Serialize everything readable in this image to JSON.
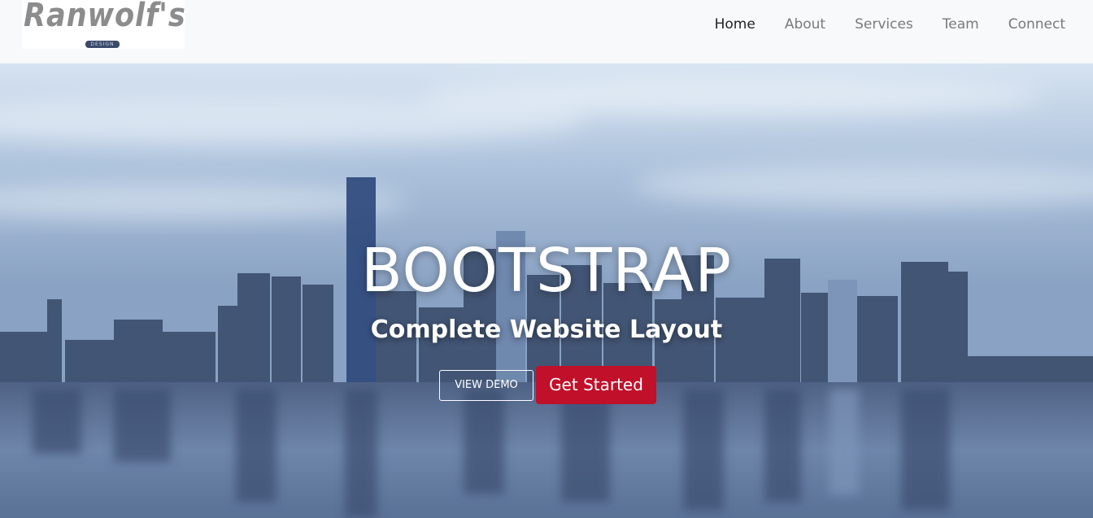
{
  "brand": {
    "logo_text": "Ranwolf's",
    "logo_subtext": "DESIGN"
  },
  "nav": {
    "items": [
      {
        "label": "Home",
        "active": true
      },
      {
        "label": "About",
        "active": false
      },
      {
        "label": "Services",
        "active": false
      },
      {
        "label": "Team",
        "active": false
      },
      {
        "label": "Connect",
        "active": false
      }
    ]
  },
  "hero": {
    "title": "BOOTSTRAP",
    "subtitle": "Complete Website Layout",
    "demo_button_label": "VIEW DEMO",
    "start_button_label": "Get Started"
  },
  "colors": {
    "navbar_bg": "#f8f9fa",
    "nav_active": "#222222",
    "nav_inactive": "#7a7a7a",
    "cta_red": "#c0102a"
  }
}
